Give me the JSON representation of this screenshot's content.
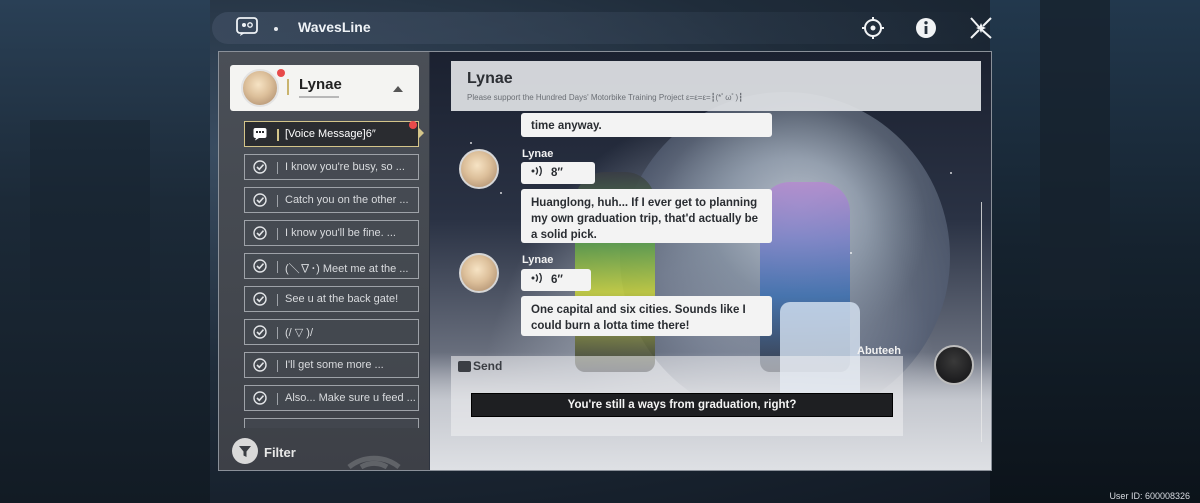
{
  "app": {
    "title": "WavesLine",
    "icon": "chat-sticker-icon"
  },
  "top_buttons": [
    {
      "name": "target-icon"
    },
    {
      "name": "info-icon"
    },
    {
      "name": "close-icon"
    }
  ],
  "contact": {
    "name": "Lynae"
  },
  "message_list": [
    {
      "text": "[Voice Message]6″",
      "icon": "voice-message-icon",
      "active": true,
      "unread": true
    },
    {
      "text": "I know you're busy, so ...",
      "icon": "check-circle-icon"
    },
    {
      "text": "Catch you on the other ...",
      "icon": "check-circle-icon"
    },
    {
      "text": "I know you'll be fine. ...",
      "icon": "check-circle-icon"
    },
    {
      "text": "(＼∇･) Meet me at the ...",
      "icon": "check-circle-icon"
    },
    {
      "text": "See u at the back gate!",
      "icon": "check-circle-icon"
    },
    {
      "text": "(/ ▽ )/",
      "icon": "check-circle-icon"
    },
    {
      "text": "I'll get some more ...",
      "icon": "check-circle-icon"
    },
    {
      "text": "Also... Make sure u feed ...",
      "icon": "check-circle-icon"
    }
  ],
  "filter": {
    "label": "Filter"
  },
  "chat": {
    "name": "Lynae",
    "signature": "Please support the Hundred Days' Motorbike Training Project ε=ε=ε=┇(*ﾟωﾟ)┇",
    "messages": [
      {
        "sender": "",
        "text": "time anyway."
      },
      {
        "sender": "Lynae",
        "voice": "8″"
      },
      {
        "sender": "",
        "text": "Huanglong, huh... If I ever get to planning my own graduation trip, that'd actually be a solid pick."
      },
      {
        "sender": "Lynae",
        "voice": "6″"
      },
      {
        "sender": "",
        "text": "One capital and six cities. Sounds like I could burn a lotta time there!"
      }
    ],
    "self_name": "Abuteeh",
    "send_label": "Send",
    "reply_option": "You're still a ways from graduation, right?"
  },
  "user_id": "User ID: 600008326",
  "colors": {
    "accent": "#d4c58a",
    "unread": "#e84a4a"
  }
}
